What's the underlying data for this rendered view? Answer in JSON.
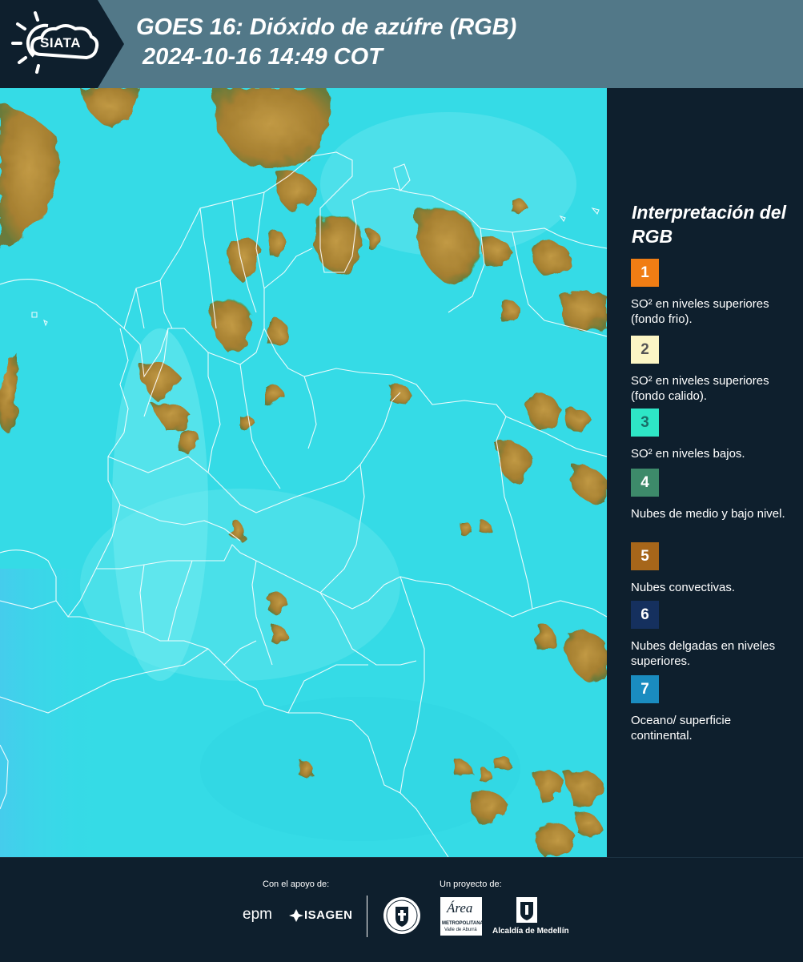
{
  "header": {
    "logo_text": "SIATA",
    "title_line1": "GOES 16: Dióxido de azúfre (RGB)",
    "title_line2": " 2024-10-16 14:49 COT"
  },
  "legend": {
    "title": "Interpretación del RGB",
    "items": [
      {
        "number": "1",
        "color": "#f07d14",
        "text_color": "#ffffff",
        "label": "SO² en niveles superiores (fondo frio)."
      },
      {
        "number": "2",
        "color": "#fcf6c5",
        "text_color": "#555555",
        "label": "SO² en niveles superiores (fondo calido)."
      },
      {
        "number": "3",
        "color": "#2ee6c6",
        "text_color": "#1a6e68",
        "label": "SO² en niveles bajos."
      },
      {
        "number": "4",
        "color": "#3d8a6a",
        "text_color": "#ffffff",
        "label": "Nubes de medio y bajo nivel."
      },
      {
        "number": "5",
        "color": "#a6661a",
        "text_color": "#ffffff",
        "label": "Nubes convectivas."
      },
      {
        "number": "6",
        "color": "#15305e",
        "text_color": "#ffffff",
        "label": "Nubes delgadas en niveles superiores."
      },
      {
        "number": "7",
        "color": "#1a8cc0",
        "text_color": "#ffffff",
        "label": "Oceano/ superficie continental."
      }
    ]
  },
  "map": {
    "background_color": "#33d9e6",
    "cloud_color": "#b48f3a",
    "border_color": "#ffffff"
  },
  "footer": {
    "support_label": "Con el apoyo de:",
    "project_label": "Un proyecto de:",
    "logo_epm": "epm",
    "logo_isagen": "ISAGEN",
    "logo_area": "Área",
    "logo_area_sub": "METROPOLITANA",
    "logo_area_sub2": "Valle de Aburrá",
    "logo_alcaldia": "Alcaldía de Medellín"
  }
}
